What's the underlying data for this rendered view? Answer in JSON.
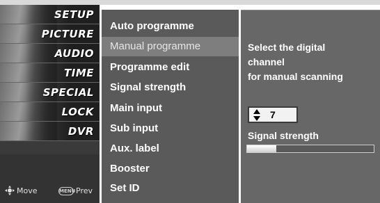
{
  "categories": [
    {
      "label": "SETUP",
      "icon": "setup-photo-icon"
    },
    {
      "label": "PICTURE",
      "icon": "picture-photo-icon"
    },
    {
      "label": "AUDIO",
      "icon": "audio-photo-icon"
    },
    {
      "label": "TIME",
      "icon": "time-photo-icon"
    },
    {
      "label": "SPECIAL",
      "icon": "special-photo-icon"
    },
    {
      "label": "LOCK",
      "icon": "lock-photo-icon"
    },
    {
      "label": "DVR",
      "icon": "dvr-photo-icon"
    }
  ],
  "footer": {
    "move_label": "Move",
    "menu_key_label": "MENU",
    "prev_label": "Prev"
  },
  "submenu": {
    "items": [
      {
        "label": "Auto programme",
        "active": false
      },
      {
        "label": "Manual programme",
        "active": true
      },
      {
        "label": "Programme edit",
        "active": false
      },
      {
        "label": "Signal strength",
        "active": false
      },
      {
        "label": "Main input",
        "active": false
      },
      {
        "label": "Sub input",
        "active": false
      },
      {
        "label": "Aux. label",
        "active": false
      },
      {
        "label": "Booster",
        "active": false
      },
      {
        "label": "Set ID",
        "active": false
      }
    ]
  },
  "detail": {
    "description": [
      "Select the digital",
      "channel",
      "for manual scanning"
    ],
    "channel_value": "7",
    "signal_title": "Signal strength",
    "signal_level": 0.23
  },
  "colors": {
    "menu_bg": "#5a5a5a",
    "active_bg": "#7e7e7e",
    "panel_bg": "#676767"
  }
}
